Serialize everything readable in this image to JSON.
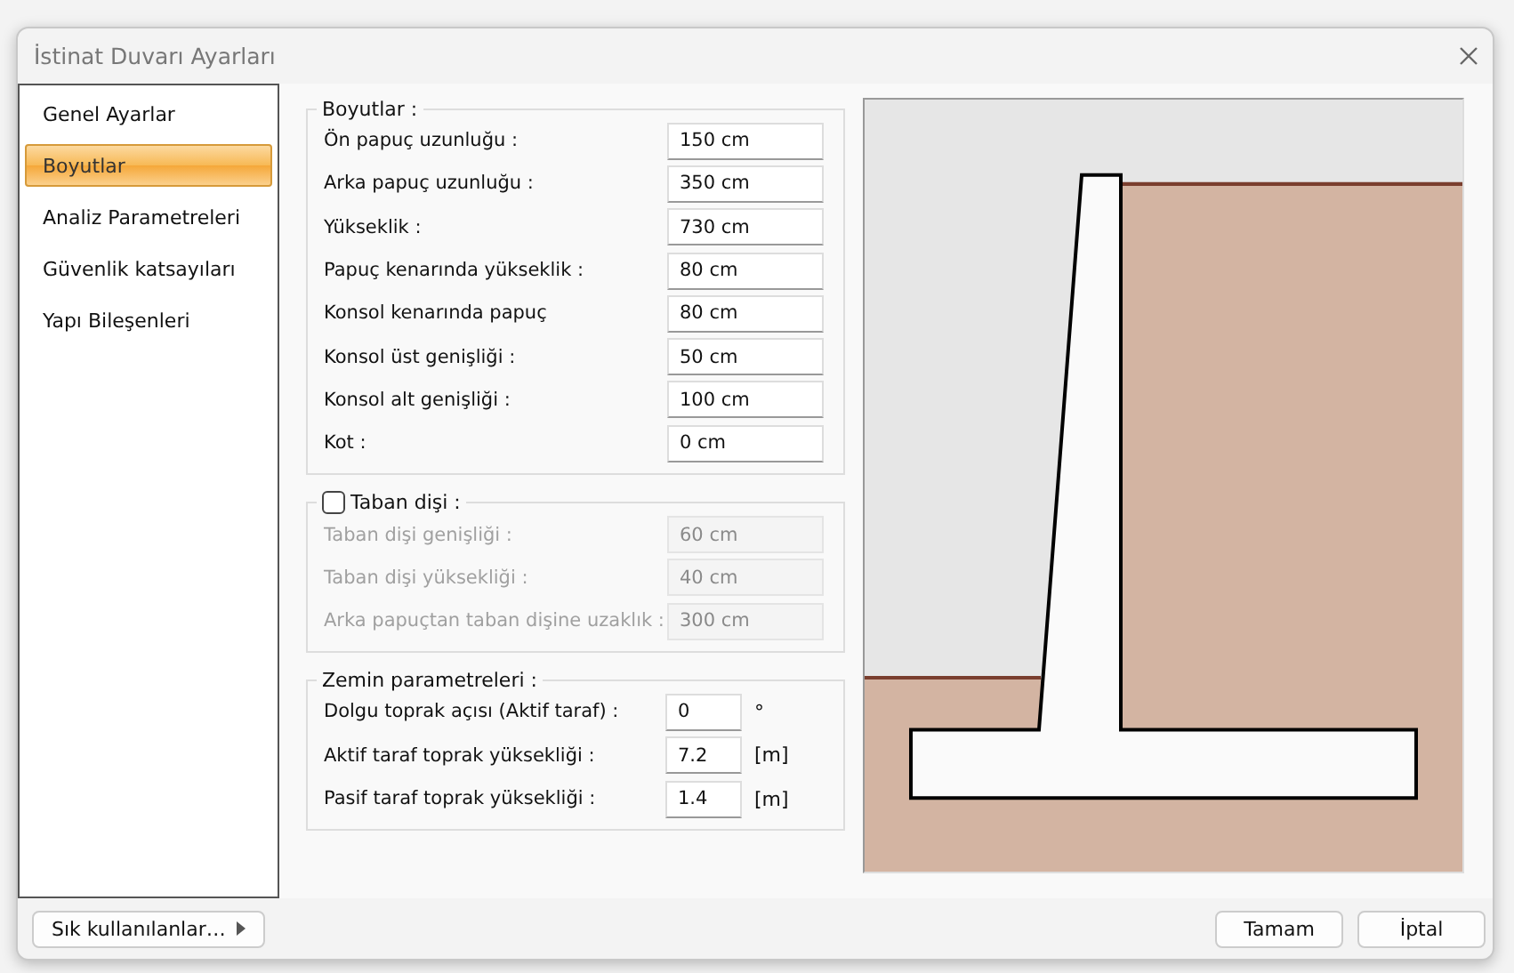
{
  "window": {
    "title": "İstinat Duvarı Ayarları"
  },
  "sidebar": {
    "items": [
      {
        "label": "Genel Ayarlar",
        "selected": false
      },
      {
        "label": "Boyutlar",
        "selected": true
      },
      {
        "label": "Analiz Parametreleri",
        "selected": false
      },
      {
        "label": "Güvenlik katsayıları",
        "selected": false
      },
      {
        "label": "Yapı Bileşenleri",
        "selected": false
      }
    ]
  },
  "dimensions": {
    "title": "Boyutlar :",
    "fields": [
      {
        "label": "Ön papuç uzunluğu :",
        "value": "150 cm"
      },
      {
        "label": "Arka papuç uzunluğu :",
        "value": "350 cm"
      },
      {
        "label": "Yükseklik :",
        "value": "730 cm"
      },
      {
        "label": "Papuç kenarında yükseklik :",
        "value": "80 cm"
      },
      {
        "label": "Konsol kenarında papuç",
        "value": "80 cm"
      },
      {
        "label": "Konsol üst genişliği :",
        "value": "50 cm"
      },
      {
        "label": "Konsol alt genişliği :",
        "value": "100 cm"
      },
      {
        "label": "Kot :",
        "value": "0 cm"
      }
    ]
  },
  "base_key": {
    "title": "Taban dişi :",
    "checked": false,
    "fields": [
      {
        "label": "Taban dişi genişliği :",
        "value": "60 cm"
      },
      {
        "label": "Taban dişi yüksekliği :",
        "value": "40 cm"
      },
      {
        "label": "Arka papuçtan taban dişine uzaklık :",
        "value": "300 cm"
      }
    ]
  },
  "soil": {
    "title": "Zemin parametreleri :",
    "fields": [
      {
        "label": "Dolgu toprak açısı (Aktif taraf) :",
        "value": "0",
        "unit": "°"
      },
      {
        "label": "Aktif taraf toprak yüksekliği :",
        "value": "7.2",
        "unit": "[m]"
      },
      {
        "label": "Pasif taraf toprak yüksekliği :",
        "value": "1.4",
        "unit": "[m]"
      }
    ]
  },
  "footer": {
    "favorites": "Sık kullanılanlar…",
    "buttons": [
      "Tamam",
      "İptal"
    ]
  }
}
